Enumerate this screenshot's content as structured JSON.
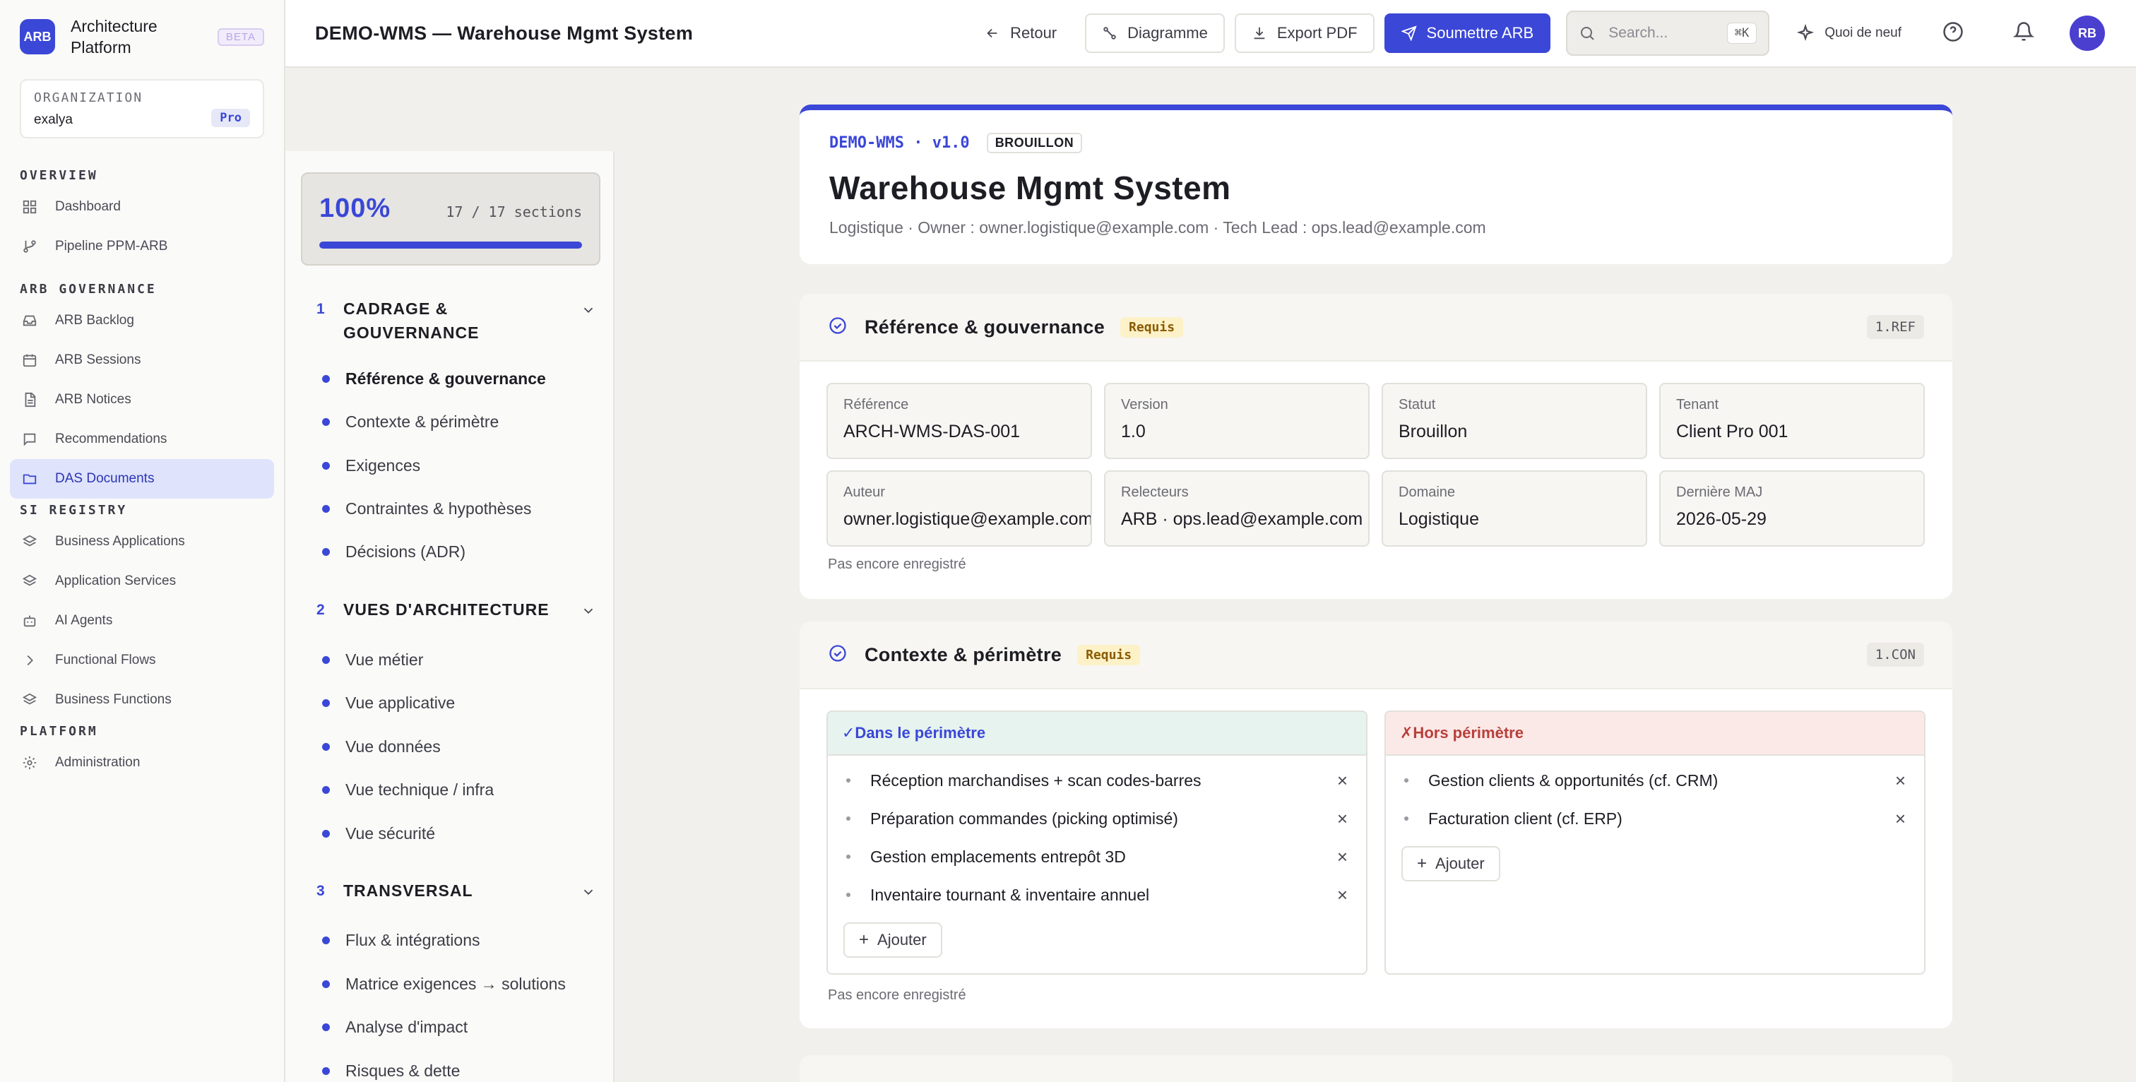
{
  "brand": {
    "logo": "ARB",
    "name": "Architecture Platform",
    "badge": "BETA"
  },
  "org": {
    "label": "ORGANIZATION",
    "name": "exalya",
    "plan": "Pro"
  },
  "sidebar": {
    "sections": [
      {
        "title": "OVERVIEW",
        "items": [
          {
            "label": "Dashboard",
            "icon": "grid-icon"
          },
          {
            "label": "Pipeline PPM-ARB",
            "icon": "git-branch-icon"
          }
        ]
      },
      {
        "title": "ARB GOVERNANCE",
        "items": [
          {
            "label": "ARB Backlog",
            "icon": "inbox-icon"
          },
          {
            "label": "ARB Sessions",
            "icon": "calendar-icon"
          },
          {
            "label": "ARB Notices",
            "icon": "file-icon"
          },
          {
            "label": "Recommendations",
            "icon": "message-icon"
          },
          {
            "label": "DAS Documents",
            "icon": "folder-icon",
            "active": true
          }
        ]
      },
      {
        "title": "SI REGISTRY",
        "items": [
          {
            "label": "Business Applications",
            "icon": "layers-icon"
          },
          {
            "label": "Application Services",
            "icon": "layers-icon"
          },
          {
            "label": "AI Agents",
            "icon": "bot-icon"
          },
          {
            "label": "Functional Flows",
            "icon": "chevron-right-icon"
          },
          {
            "label": "Business Functions",
            "icon": "layers-icon"
          }
        ]
      },
      {
        "title": "PLATFORM",
        "items": [
          {
            "label": "Administration",
            "icon": "gear-icon"
          }
        ]
      }
    ]
  },
  "topbar": {
    "title": "DEMO-WMS — Warehouse Mgmt System",
    "back": "Retour",
    "diagram": "Diagramme",
    "export": "Export PDF",
    "submit": "Soumettre ARB",
    "search_placeholder": "Search...",
    "search_kbd": "⌘K",
    "whats_new": "Quoi de neuf",
    "avatar": "RB"
  },
  "progress": {
    "percent_label": "100%",
    "count": "17 / 17 sections",
    "fraction": 1.0
  },
  "sections_nav": {
    "groups": [
      {
        "num": "1",
        "title": "CADRAGE & GOUVERNANCE",
        "items": [
          "Référence & gouvernance",
          "Contexte & périmètre",
          "Exigences",
          "Contraintes & hypothèses",
          "Décisions (ADR)"
        ]
      },
      {
        "num": "2",
        "title": "VUES D'ARCHITECTURE",
        "items": [
          "Vue métier",
          "Vue applicative",
          "Vue données",
          "Vue technique / infra",
          "Vue sécurité"
        ]
      },
      {
        "num": "3",
        "title": "TRANSVERSAL",
        "items": [
          "Flux & intégrations",
          "Matrice exigences → solutions",
          "Analyse d'impact",
          "Risques & dette"
        ]
      }
    ]
  },
  "doc": {
    "id": "DEMO-WMS · v1.0",
    "status_badge": "BROUILLON",
    "title": "Warehouse Mgmt System",
    "subtitle": "Logistique · Owner : owner.logistique@example.com · Tech Lead : ops.lead@example.com"
  },
  "ref_card": {
    "title": "Référence & gouvernance",
    "required": "Requis",
    "code": "1.REF",
    "fields": [
      {
        "label": "Référence",
        "value": "ARCH-WMS-DAS-001"
      },
      {
        "label": "Version",
        "value": "1.0"
      },
      {
        "label": "Statut",
        "value": "Brouillon"
      },
      {
        "label": "Tenant",
        "value": "Client Pro 001"
      },
      {
        "label": "Auteur",
        "value": "owner.logistique@example.com"
      },
      {
        "label": "Relecteurs",
        "value": "ARB · ops.lead@example.com"
      },
      {
        "label": "Domaine",
        "value": "Logistique"
      },
      {
        "label": "Dernière MAJ",
        "value": "2026-05-29"
      }
    ],
    "save_state": "Pas encore enregistré"
  },
  "ctx_card": {
    "title": "Contexte & périmètre",
    "required": "Requis",
    "code": "1.CON",
    "in_scope": {
      "title": "✓Dans le périmètre",
      "items": [
        "Réception marchandises + scan codes-barres",
        "Préparation commandes (picking optimisé)",
        "Gestion emplacements entrepôt 3D",
        "Inventaire tournant & inventaire annuel"
      ]
    },
    "out_scope": {
      "title": "✗Hors périmètre",
      "items": [
        "Gestion clients & opportunités (cf. CRM)",
        "Facturation client (cf. ERP)"
      ]
    },
    "add_label": "Ajouter",
    "save_state": "Pas encore enregistré"
  }
}
